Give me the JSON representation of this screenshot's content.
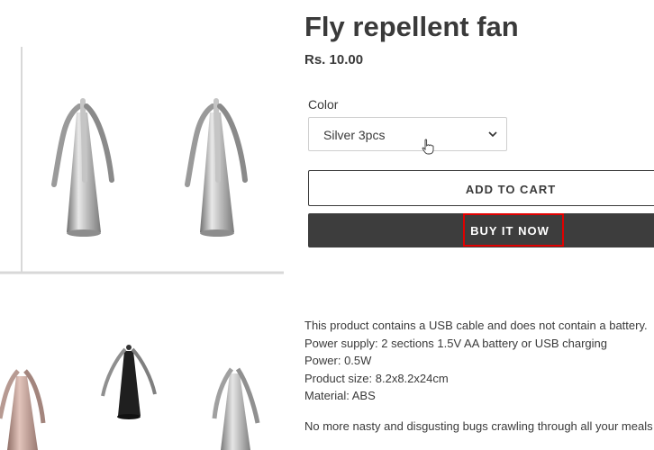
{
  "product": {
    "title": "Fly repellent fan",
    "price": "Rs. 10.00",
    "option_label": "Color",
    "option_value": "Silver 3pcs",
    "add_to_cart": "ADD TO CART",
    "buy_now": "BUY IT NOW"
  },
  "description": {
    "lines": [
      "This product contains a USB cable and does not contain a battery.",
      "Power supply: 2 sections 1.5V AA battery or USB charging",
      "Power: 0.5W",
      "Product size: 8.2x8.2x24cm",
      "Material: ABS"
    ],
    "paragraph2": "No more nasty and disgusting bugs crawling through all your meals"
  },
  "colors": {
    "text": "#3a3a3a",
    "buy_now_bg": "#3d3d3d",
    "highlight": "#e10000",
    "silver": "#c0c0c0",
    "rose_gold": "#c9a49a",
    "black": "#222222"
  },
  "icons": {
    "select_arrow": "chevron-down-icon",
    "cursor": "hand-pointer-icon"
  }
}
